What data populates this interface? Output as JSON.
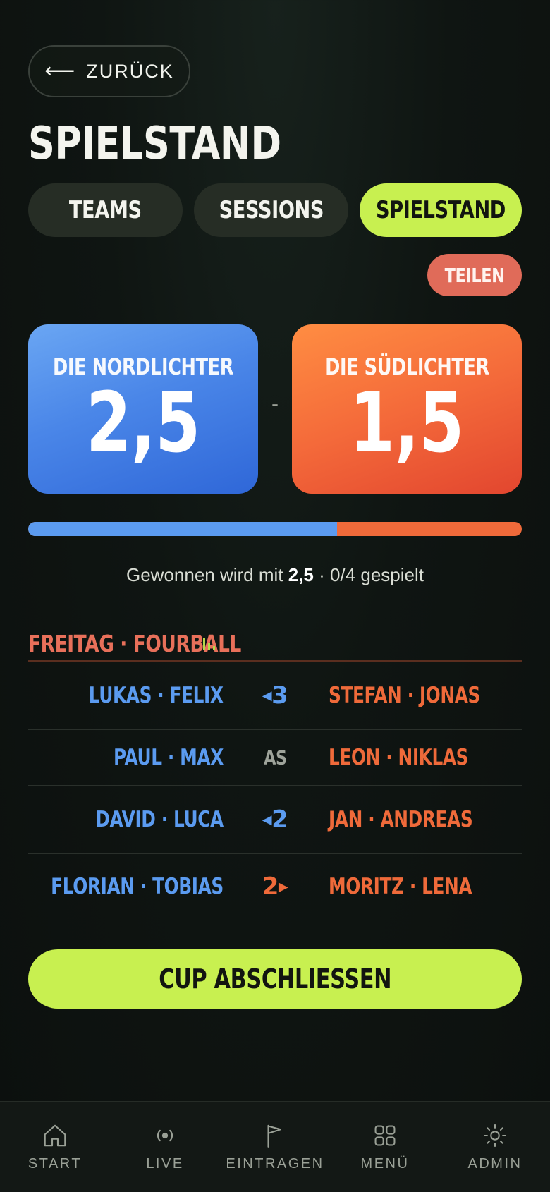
{
  "back": {
    "label": "ZURÜCK",
    "icon": "arrow-left-icon"
  },
  "page_title": "SPIELSTAND",
  "tabs": [
    {
      "label": "TEAMS",
      "active": false
    },
    {
      "label": "SESSIONS",
      "active": false
    },
    {
      "label": "SPIELSTAND",
      "active": true
    }
  ],
  "share_label": "TEILEN",
  "score": {
    "team_a": {
      "name": "DIE NORDLICHTER",
      "points": "2,5",
      "color": "#4a86e8"
    },
    "separator": "-",
    "team_b": {
      "name": "DIE SÜDLICHTER",
      "points": "1,5",
      "color": "#f46a3a"
    },
    "progress_team_a_fraction": 0.625
  },
  "win_info": {
    "prefix": "Gewonnen wird mit ",
    "target": "2,5",
    "suffix": " · 0/4 gespielt"
  },
  "session": {
    "title": "FREITAG · FOURBALL",
    "matches": [
      {
        "left": "LUKAS · FELIX",
        "status": "3",
        "leader": "left",
        "right": "STEFAN · JONAS"
      },
      {
        "left": "PAUL · MAX",
        "status": "AS",
        "leader": "none",
        "right": "LEON · NIKLAS"
      },
      {
        "left": "DAVID · LUCA",
        "status": "2",
        "leader": "left",
        "right": "JAN · ANDREAS"
      },
      {
        "left": "FLORIAN · TOBIAS",
        "status": "2",
        "leader": "right",
        "right": "MORITZ · LENA"
      }
    ]
  },
  "cta_label": "CUP ABSCHLIESSEN",
  "nav": [
    {
      "label": "START",
      "icon": "home-icon"
    },
    {
      "label": "LIVE",
      "icon": "live-icon"
    },
    {
      "label": "EINTRAGEN",
      "icon": "flag-icon"
    },
    {
      "label": "MENÜ",
      "icon": "grid-icon"
    },
    {
      "label": "ADMIN",
      "icon": "sun-icon"
    }
  ]
}
